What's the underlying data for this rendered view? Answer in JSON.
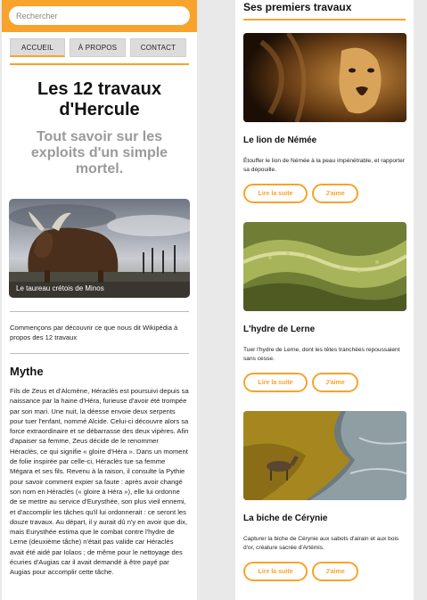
{
  "search": {
    "placeholder": "Rechercher"
  },
  "nav": {
    "home": "ACCUEIL",
    "about": "À PROPOS",
    "contact": "CONTACT"
  },
  "header": {
    "title": "Les 12 travaux d'Hercule",
    "subtitle": "Tout savoir sur les exploits d'un simple mortel."
  },
  "hero": {
    "caption": "Le taureau crétois de Minos"
  },
  "intro": "Commençons par découvrir ce que nous dit Wikipédia à propos des 12 travaux",
  "mythe": {
    "heading": "Mythe",
    "text": "Fils de Zeus et d'Alcmène, Héraclès est poursuivi depuis sa naissance par la haine d'Héra, furieuse d'avoir été trompée par son mari. Une nuit, la déesse envoie deux serpents pour tuer l'enfant, nommé Alcide. Celui-ci découvre alors sa force extraordinaire et se débarrasse des deux vipères. Afin d'apaiser sa femme, Zeus décide de le renommer Héraclès, ce qui signifie « gloire d'Héra ». Dans un moment de folie inspirée par celle-ci, Héraclès tue sa femme Mégara et ses fils. Revenu à la raison, il consulte la Pythie pour savoir comment expier sa faute : après avoir changé son nom en Héraclès (« gloire à Héra »), elle lui ordonne de se mettre au service d'Eurysthée, son plus vieil ennemi, et d'accomplir les tâches qu'il lui ordonnerait : ce seront les douze travaux. Au départ, il y aurait dû n'y en avoir que dix, mais Eurysthée estima que le combat contre l'hydre de Lerne (deuxième tâche) n'était pas valide car Héraclès avait été aidé par Iolaos ; de même pour le nettoyage des écuries d'Augias car il avait demandé à être payé par Augias pour accomplir cette tâche."
  },
  "works": {
    "title": "Ses premiers travaux",
    "cards": [
      {
        "title": "Le lion de Némée",
        "text": "Étouffer le lion de Némée à la peau impénétrable, et rapporter sa dépouille.",
        "read": "Lire la suite",
        "like": "J'aime"
      },
      {
        "title": "L'hydre de Lerne",
        "text": "Tuer l'hydre de Lerne, dont les têtes tranchées repoussaient sans cesse.",
        "read": "Lire la suite",
        "like": "J'aime"
      },
      {
        "title": "La biche de Cérynie",
        "text": "Capturer la biche de Cérynie aux sabots d'airain et aux bois d'or, créature sacrée d'Artémis.",
        "read": "Lire la suite",
        "like": "J'aime"
      }
    ]
  },
  "colors": {
    "accent": "#f7a32c",
    "subtitle": "#9a9a9a"
  }
}
